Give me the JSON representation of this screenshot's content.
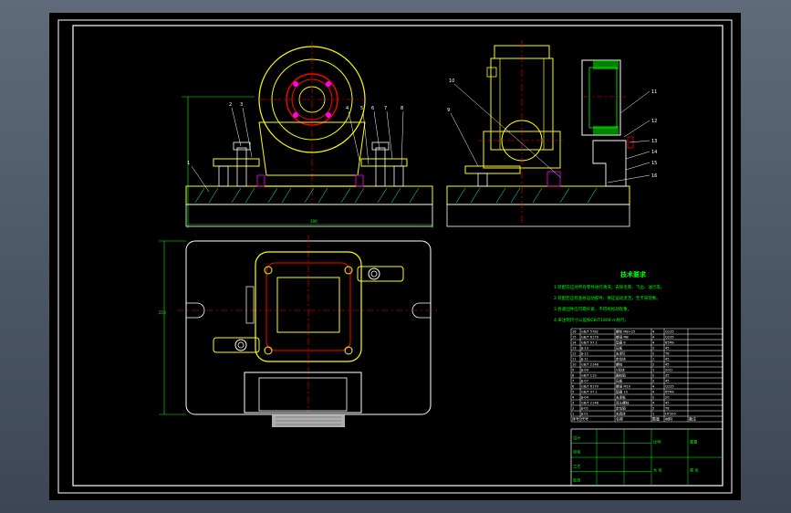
{
  "drawing": {
    "tech_title": "技术要求",
    "notes": [
      "1.装配前应对所有零件进行清洗，去除毛刺、飞边、油污等。",
      "2.装配后应检查各运动部件，保证运动灵活，无卡滞现象。",
      "3.各紧固件应可靠拧紧，不得有松动现象。",
      "4.未注明尺寸公差按GB/T1804-m执行。"
    ],
    "leader_labels_front": [
      "1",
      "2",
      "3",
      "4",
      "5",
      "6",
      "7",
      "8"
    ],
    "leader_labels_side": [
      "9",
      "10",
      "11",
      "12",
      "13",
      "14",
      "15",
      "16"
    ],
    "bom_header": [
      "序号",
      "代号",
      "名称",
      "数量",
      "材料",
      "备注"
    ],
    "bom_rows": [
      [
        "16",
        "GB/T 5782",
        "螺栓 M8×25",
        "4",
        "Q235",
        ""
      ],
      [
        "15",
        "GB/T 6170",
        "螺母 M8",
        "4",
        "Q235",
        ""
      ],
      [
        "14",
        "GB/T 97.1",
        "垫圈 8",
        "4",
        "65Mn",
        ""
      ],
      [
        "13",
        "JJ-13",
        "压板",
        "2",
        "45",
        ""
      ],
      [
        "12",
        "JJ-12",
        "支承钉",
        "2",
        "T8",
        ""
      ],
      [
        "11",
        "JJ-11",
        "定位块",
        "1",
        "45",
        ""
      ],
      [
        "10",
        "GB/T 2148",
        "螺柱",
        "2",
        "45",
        ""
      ],
      [
        "9",
        "JJ-09",
        "V形块",
        "1",
        "20Cr",
        ""
      ],
      [
        "8",
        "GB/T 119",
        "圆柱销",
        "2",
        "35",
        ""
      ],
      [
        "7",
        "JJ-07",
        "压板",
        "2",
        "45",
        ""
      ],
      [
        "6",
        "GB/T 6170",
        "螺母 M10",
        "4",
        "Q235",
        ""
      ],
      [
        "5",
        "GB/T 97.1",
        "垫圈 10",
        "4",
        "65Mn",
        ""
      ],
      [
        "4",
        "JJ-04",
        "支承板",
        "2",
        "20",
        ""
      ],
      [
        "3",
        "GB/T 2148",
        "双头螺柱",
        "4",
        "45",
        ""
      ],
      [
        "2",
        "JJ-02",
        "定位销",
        "2",
        "T8",
        ""
      ],
      [
        "1",
        "JJ-01",
        "夹具体",
        "1",
        "HT200",
        ""
      ]
    ],
    "title_block": [
      "设计",
      "审核",
      "工艺",
      "批准",
      "比例",
      "重量",
      "共 张",
      "第 张"
    ],
    "dim_front_width": "390",
    "dim_height": "210"
  },
  "colors": {
    "frame": "#ffffff",
    "part": "#ffff00",
    "cut": "#00ff00",
    "center": "#ff0000",
    "hatch": "#00ffff",
    "dim": "#00ff00",
    "highlight": "#ff00ff"
  }
}
